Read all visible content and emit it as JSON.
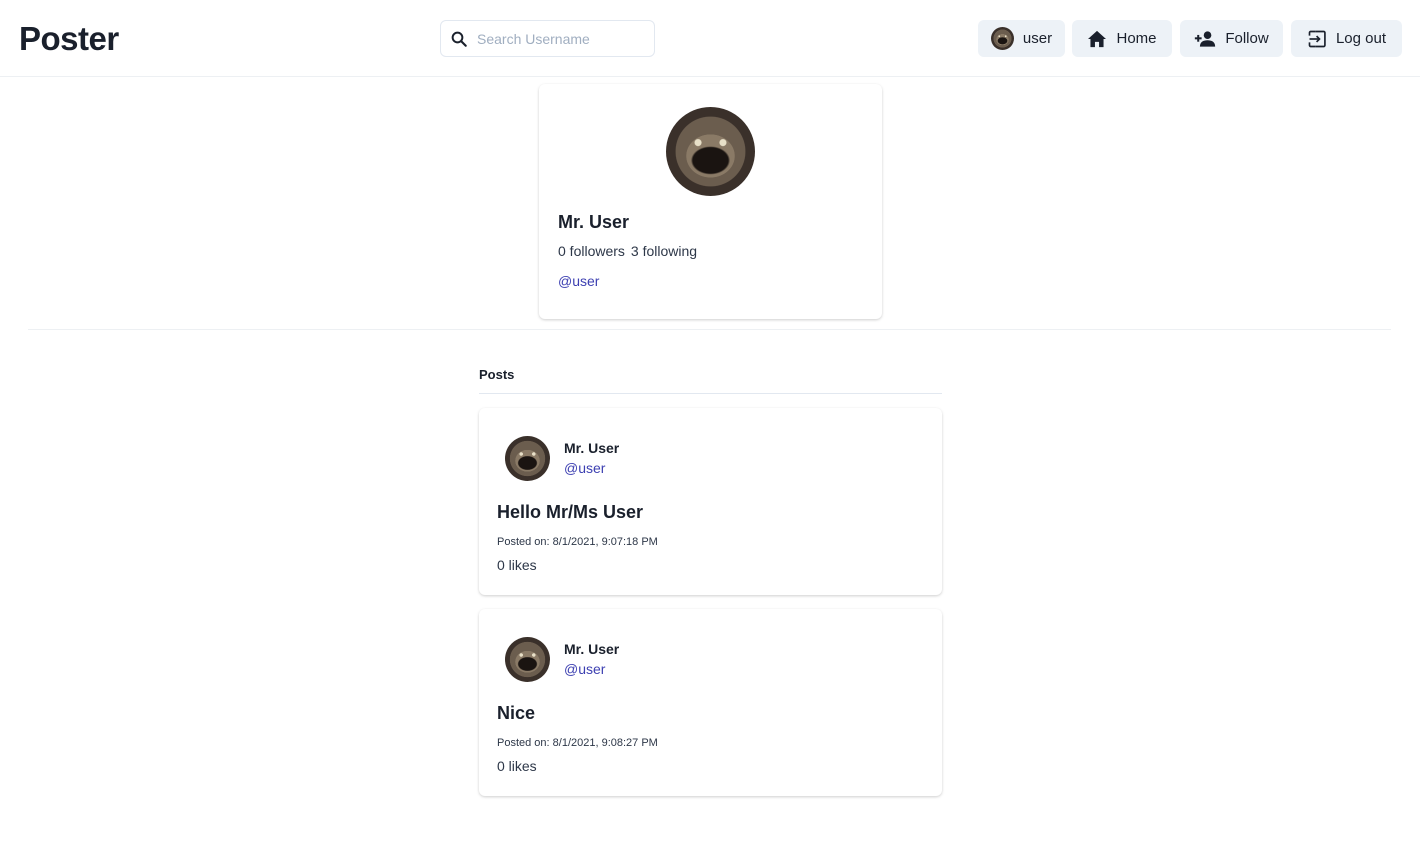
{
  "header": {
    "logo": "Poster",
    "search": {
      "placeholder": "Search Username",
      "value": ""
    },
    "nav": {
      "user_label": "user",
      "home_label": "Home",
      "follow_label": "Follow",
      "logout_label": "Log out"
    }
  },
  "profile": {
    "name": "Mr. User",
    "followers": "0 followers",
    "following": "3 following",
    "handle": "@user"
  },
  "posts_section": {
    "heading": "Posts",
    "items": [
      {
        "author": "Mr. User",
        "handle": "@user",
        "title": "Hello Mr/Ms User",
        "date": "Posted on: 8/1/2021, 9:07:18 PM",
        "likes": "0 likes"
      },
      {
        "author": "Mr. User",
        "handle": "@user",
        "title": "Nice",
        "date": "Posted on: 8/1/2021, 9:08:27 PM",
        "likes": "0 likes"
      }
    ]
  },
  "colors": {
    "accent_link": "#3c3fb1",
    "button_bg": "#edf2f7",
    "text": "#1a202c"
  },
  "icons": [
    "search-icon",
    "home-icon",
    "person-add-icon",
    "logout-icon"
  ]
}
